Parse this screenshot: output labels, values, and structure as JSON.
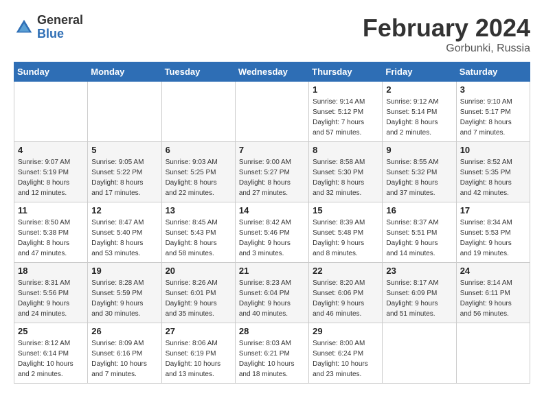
{
  "header": {
    "logo_general": "General",
    "logo_blue": "Blue",
    "month_title": "February 2024",
    "location": "Gorbunki, Russia"
  },
  "days_of_week": [
    "Sunday",
    "Monday",
    "Tuesday",
    "Wednesday",
    "Thursday",
    "Friday",
    "Saturday"
  ],
  "weeks": [
    [
      {
        "day": "",
        "info": ""
      },
      {
        "day": "",
        "info": ""
      },
      {
        "day": "",
        "info": ""
      },
      {
        "day": "",
        "info": ""
      },
      {
        "day": "1",
        "info": "Sunrise: 9:14 AM\nSunset: 5:12 PM\nDaylight: 7 hours\nand 57 minutes."
      },
      {
        "day": "2",
        "info": "Sunrise: 9:12 AM\nSunset: 5:14 PM\nDaylight: 8 hours\nand 2 minutes."
      },
      {
        "day": "3",
        "info": "Sunrise: 9:10 AM\nSunset: 5:17 PM\nDaylight: 8 hours\nand 7 minutes."
      }
    ],
    [
      {
        "day": "4",
        "info": "Sunrise: 9:07 AM\nSunset: 5:19 PM\nDaylight: 8 hours\nand 12 minutes."
      },
      {
        "day": "5",
        "info": "Sunrise: 9:05 AM\nSunset: 5:22 PM\nDaylight: 8 hours\nand 17 minutes."
      },
      {
        "day": "6",
        "info": "Sunrise: 9:03 AM\nSunset: 5:25 PM\nDaylight: 8 hours\nand 22 minutes."
      },
      {
        "day": "7",
        "info": "Sunrise: 9:00 AM\nSunset: 5:27 PM\nDaylight: 8 hours\nand 27 minutes."
      },
      {
        "day": "8",
        "info": "Sunrise: 8:58 AM\nSunset: 5:30 PM\nDaylight: 8 hours\nand 32 minutes."
      },
      {
        "day": "9",
        "info": "Sunrise: 8:55 AM\nSunset: 5:32 PM\nDaylight: 8 hours\nand 37 minutes."
      },
      {
        "day": "10",
        "info": "Sunrise: 8:52 AM\nSunset: 5:35 PM\nDaylight: 8 hours\nand 42 minutes."
      }
    ],
    [
      {
        "day": "11",
        "info": "Sunrise: 8:50 AM\nSunset: 5:38 PM\nDaylight: 8 hours\nand 47 minutes."
      },
      {
        "day": "12",
        "info": "Sunrise: 8:47 AM\nSunset: 5:40 PM\nDaylight: 8 hours\nand 53 minutes."
      },
      {
        "day": "13",
        "info": "Sunrise: 8:45 AM\nSunset: 5:43 PM\nDaylight: 8 hours\nand 58 minutes."
      },
      {
        "day": "14",
        "info": "Sunrise: 8:42 AM\nSunset: 5:46 PM\nDaylight: 9 hours\nand 3 minutes."
      },
      {
        "day": "15",
        "info": "Sunrise: 8:39 AM\nSunset: 5:48 PM\nDaylight: 9 hours\nand 8 minutes."
      },
      {
        "day": "16",
        "info": "Sunrise: 8:37 AM\nSunset: 5:51 PM\nDaylight: 9 hours\nand 14 minutes."
      },
      {
        "day": "17",
        "info": "Sunrise: 8:34 AM\nSunset: 5:53 PM\nDaylight: 9 hours\nand 19 minutes."
      }
    ],
    [
      {
        "day": "18",
        "info": "Sunrise: 8:31 AM\nSunset: 5:56 PM\nDaylight: 9 hours\nand 24 minutes."
      },
      {
        "day": "19",
        "info": "Sunrise: 8:28 AM\nSunset: 5:59 PM\nDaylight: 9 hours\nand 30 minutes."
      },
      {
        "day": "20",
        "info": "Sunrise: 8:26 AM\nSunset: 6:01 PM\nDaylight: 9 hours\nand 35 minutes."
      },
      {
        "day": "21",
        "info": "Sunrise: 8:23 AM\nSunset: 6:04 PM\nDaylight: 9 hours\nand 40 minutes."
      },
      {
        "day": "22",
        "info": "Sunrise: 8:20 AM\nSunset: 6:06 PM\nDaylight: 9 hours\nand 46 minutes."
      },
      {
        "day": "23",
        "info": "Sunrise: 8:17 AM\nSunset: 6:09 PM\nDaylight: 9 hours\nand 51 minutes."
      },
      {
        "day": "24",
        "info": "Sunrise: 8:14 AM\nSunset: 6:11 PM\nDaylight: 9 hours\nand 56 minutes."
      }
    ],
    [
      {
        "day": "25",
        "info": "Sunrise: 8:12 AM\nSunset: 6:14 PM\nDaylight: 10 hours\nand 2 minutes."
      },
      {
        "day": "26",
        "info": "Sunrise: 8:09 AM\nSunset: 6:16 PM\nDaylight: 10 hours\nand 7 minutes."
      },
      {
        "day": "27",
        "info": "Sunrise: 8:06 AM\nSunset: 6:19 PM\nDaylight: 10 hours\nand 13 minutes."
      },
      {
        "day": "28",
        "info": "Sunrise: 8:03 AM\nSunset: 6:21 PM\nDaylight: 10 hours\nand 18 minutes."
      },
      {
        "day": "29",
        "info": "Sunrise: 8:00 AM\nSunset: 6:24 PM\nDaylight: 10 hours\nand 23 minutes."
      },
      {
        "day": "",
        "info": ""
      },
      {
        "day": "",
        "info": ""
      }
    ]
  ]
}
